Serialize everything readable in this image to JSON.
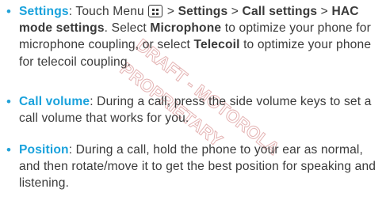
{
  "items": [
    {
      "term": "Settings",
      "segments": [
        ": Touch Menu ",
        " > ",
        "Settings",
        " > ",
        "Call settings",
        " > ",
        "HAC mode settings",
        ". Select ",
        "Microphone",
        " to optimize your phone for microphone coupling, or select ",
        "Telecoil",
        " to optimize your phone for telecoil coupling."
      ],
      "menu_icon": "menu-key-icon"
    },
    {
      "term": "Call volume",
      "body": ": During a call, press the side volume keys to set a call volume that works for you."
    },
    {
      "term": "Position",
      "body": ": During a call, hold the phone to your ear as normal, and then rotate/move it to get the best position for speaking and listening."
    }
  ],
  "colors": {
    "accent": "#1aa2dc",
    "text": "#3a3a3a",
    "watermark": "#d8a0a0"
  }
}
